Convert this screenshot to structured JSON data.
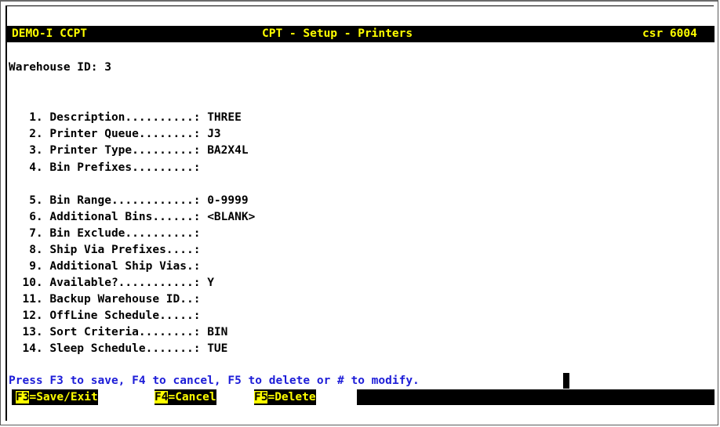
{
  "header": {
    "left": "DEMO-I CCPT",
    "center": "CPT - Setup - Printers",
    "right": "csr 6004"
  },
  "warehouse_line": "Warehouse ID: 3",
  "fields": [
    {
      "label": " 1. Description..........:",
      "value": "THREE"
    },
    {
      "label": " 2. Printer Queue........:",
      "value": "J3"
    },
    {
      "label": " 3. Printer Type.........:",
      "value": "BA2X4L"
    },
    {
      "label": " 4. Bin Prefixes.........:",
      "value": ""
    },
    {
      "label": " 5. Bin Range............:",
      "value": "0-9999"
    },
    {
      "label": " 6. Additional Bins......:",
      "value": "<BLANK>"
    },
    {
      "label": " 7. Bin Exclude..........:",
      "value": ""
    },
    {
      "label": " 8. Ship Via Prefixes....:",
      "value": ""
    },
    {
      "label": " 9. Additional Ship Vias.:",
      "value": ""
    },
    {
      "label": "10. Available?...........:",
      "value": "Y"
    },
    {
      "label": "11. Backup Warehouse ID..:",
      "value": ""
    },
    {
      "label": "12. OffLine Schedule.....:",
      "value": ""
    },
    {
      "label": "13. Sort Criteria........:",
      "value": "BIN"
    },
    {
      "label": "14. Sleep Schedule.......:",
      "value": "TUE"
    }
  ],
  "prompt": "Press F3 to save, F4 to cancel, F5 to delete or # to modify.",
  "function_keys": [
    {
      "key": "F3",
      "label": "Save/Exit"
    },
    {
      "key": "F4",
      "label": "Cancel"
    },
    {
      "key": "F5",
      "label": "Delete"
    }
  ],
  "colors": {
    "background": "#ffffff",
    "text": "#000000",
    "header_bg": "#000000",
    "header_fg": "#ffff00",
    "prompt": "#1d1dd8"
  }
}
